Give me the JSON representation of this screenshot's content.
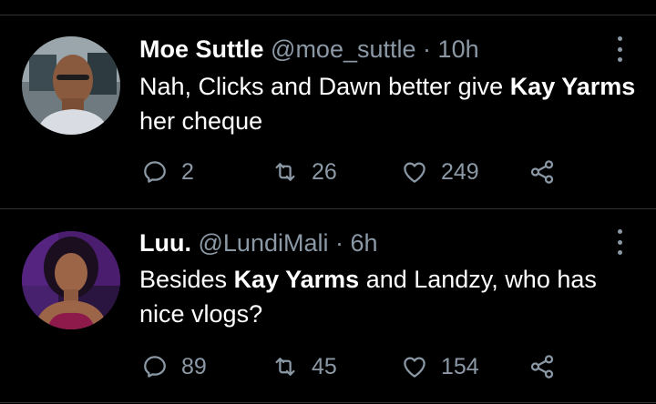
{
  "tweets": [
    {
      "name": "Moe Suttle",
      "handle": "@moe_suttle",
      "separator": "·",
      "time": "10h",
      "text_parts": [
        "Nah, Clicks and Dawn better give ",
        "Kay Yarms",
        " her cheque"
      ],
      "replies": "2",
      "retweets": "26",
      "likes": "249"
    },
    {
      "name": "Luu.",
      "handle": "@LundiMali",
      "separator": "·",
      "time": "6h",
      "text_parts": [
        "Besides ",
        "Kay Yarms",
        " and Landzy, who has nice vlogs?"
      ],
      "replies": "89",
      "retweets": "45",
      "likes": "154"
    }
  ],
  "icons": {
    "reply": "reply-icon",
    "retweet": "retweet-icon",
    "like": "heart-icon",
    "share": "share-icon",
    "more": "more-options-icon"
  },
  "colors": {
    "background": "#000000",
    "text": "#ffffff",
    "secondary": "#8b98a5",
    "divider": "#2f3336"
  }
}
